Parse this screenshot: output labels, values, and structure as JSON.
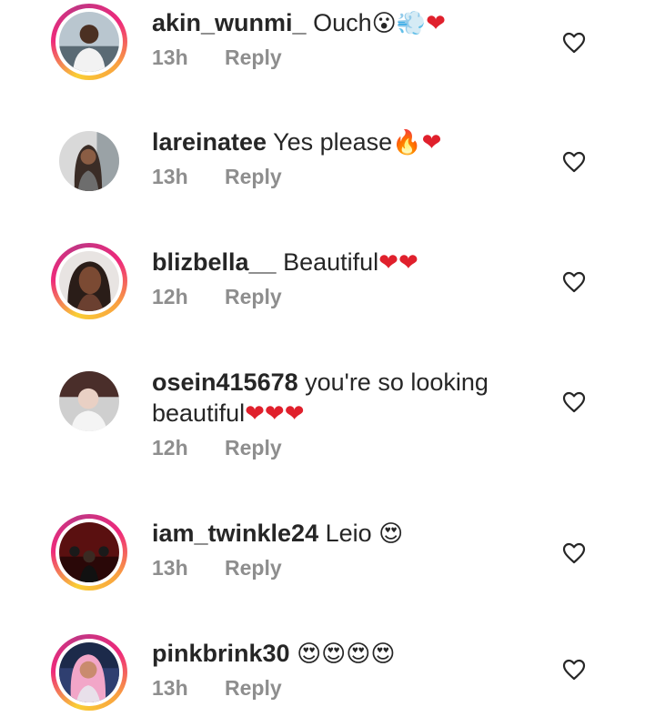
{
  "comments": [
    {
      "username": "akin_wunmi_",
      "text": " Ouch",
      "emojis": [
        "😮",
        "💨",
        "❤"
      ],
      "time": "13h",
      "reply_label": "Reply",
      "avatar_icon": "profile-photo-man",
      "story_ring": true
    },
    {
      "username": "lareinatee",
      "text": " Yes please",
      "emojis": [
        "🔥",
        "❤"
      ],
      "time": "13h",
      "reply_label": "Reply",
      "avatar_icon": "profile-photo-woman",
      "story_ring": false
    },
    {
      "username": "blizbella__",
      "text": " Beautiful",
      "emojis": [
        "❤",
        "❤"
      ],
      "time": "12h",
      "reply_label": "Reply",
      "avatar_icon": "profile-photo-woman",
      "story_ring": true
    },
    {
      "username": "osein415678",
      "text": " you're so looking",
      "text_line2": "beautiful",
      "emojis": [
        "❤",
        "❤",
        "❤"
      ],
      "time": "12h",
      "reply_label": "Reply",
      "avatar_icon": "profile-photo-man",
      "story_ring": false
    },
    {
      "username": "iam_twinkle24",
      "text": " Leio",
      "emojis": [
        "😍"
      ],
      "time": "13h",
      "reply_label": "Reply",
      "avatar_icon": "profile-photo-group",
      "story_ring": true
    },
    {
      "username": "pinkbrink30",
      "text": " ",
      "emojis": [
        "😍",
        "😍",
        "😍",
        "😍"
      ],
      "time": "13h",
      "reply_label": "Reply",
      "avatar_icon": "profile-photo-woman",
      "story_ring": true
    }
  ],
  "colors": {
    "heart": "#e0202c",
    "meta_text": "#8e8e8e",
    "text": "#262626",
    "story_ring": "#ee2a7b"
  },
  "icons": {
    "like": "heart-outline-icon"
  }
}
